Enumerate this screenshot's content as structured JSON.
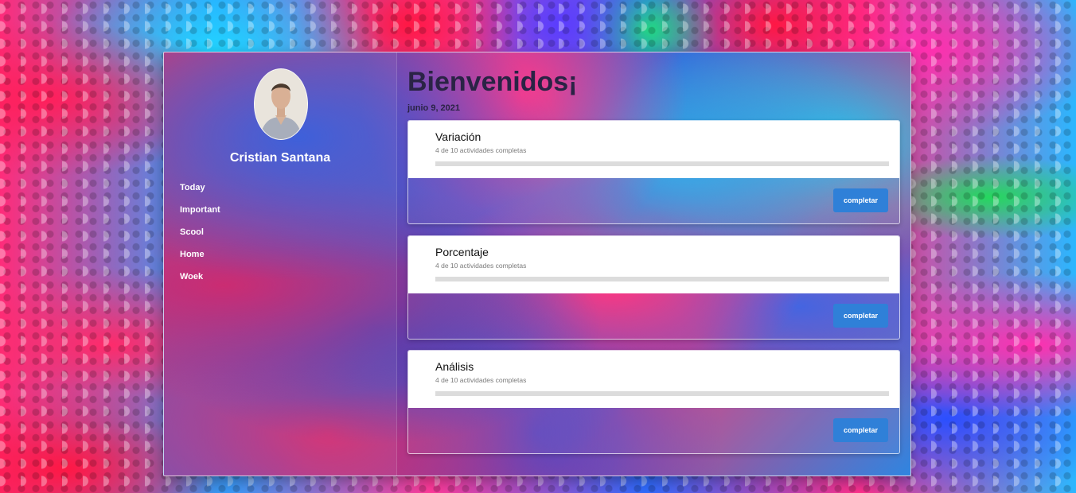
{
  "profile": {
    "name": "Cristian Santana"
  },
  "nav": {
    "items": [
      {
        "label": "Today"
      },
      {
        "label": "Important"
      },
      {
        "label": "Scool"
      },
      {
        "label": "Home"
      },
      {
        "label": "Woek"
      }
    ]
  },
  "header": {
    "title": "Bienvenidos¡",
    "date": "junio 9, 2021"
  },
  "tasks": [
    {
      "title": "Variación",
      "subtitle": "4 de 10 actividades completas",
      "completed": 4,
      "total": 10,
      "button_label": "completar"
    },
    {
      "title": "Porcentaje",
      "subtitle": "4 de 10 actividades completas",
      "completed": 4,
      "total": 10,
      "button_label": "completar"
    },
    {
      "title": "Análisis",
      "subtitle": "4 de 10 actividades completas",
      "completed": 4,
      "total": 10,
      "button_label": "completar"
    }
  ],
  "colors": {
    "button": "#2f80d8",
    "title_text": "#2a2345",
    "progress_track": "#dcdcdc"
  }
}
